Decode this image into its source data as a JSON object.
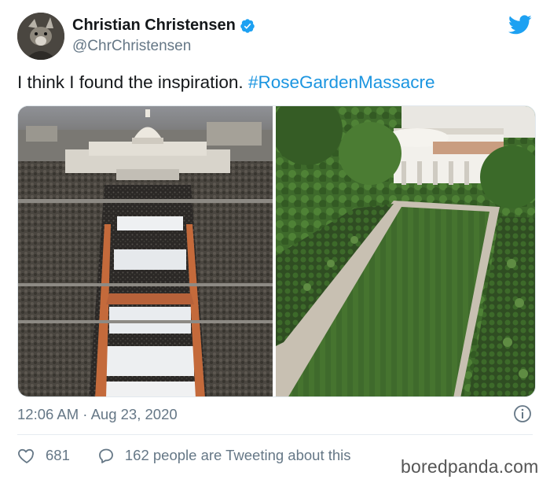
{
  "tweet": {
    "display_name": "Christian Christensen",
    "handle": "@ChrChristensen",
    "text": "I think I found the inspiration. ",
    "hashtag": "#RoseGardenMassacre",
    "time": "12:06 AM · Aug 23, 2020",
    "like_count": "681",
    "reply_text": "162 people are Tweeting about this"
  },
  "watermark": "boredpanda.com",
  "icons": {
    "avatar": "avatar-photo",
    "verified": "verified-badge-icon",
    "logo": "twitter-bird-icon",
    "info": "info-icon",
    "like": "heart-icon",
    "reply": "speech-bubble-icon"
  },
  "colors": {
    "accent": "#1b95e0",
    "muted": "#657786",
    "text": "#14171a"
  }
}
